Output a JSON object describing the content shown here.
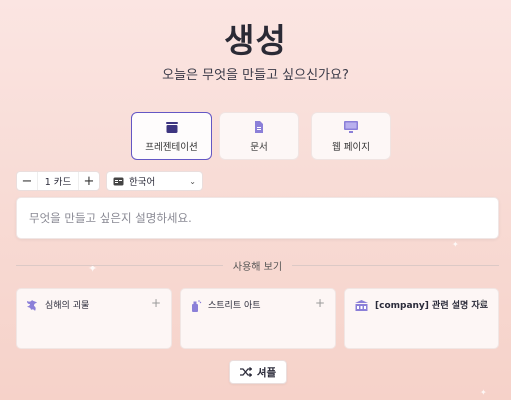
{
  "header": {
    "title": "생성",
    "subtitle": "오늘은 무엇을 만들고 싶으신가요?"
  },
  "types": [
    {
      "label": "프레젠테이션",
      "icon": "presentation-icon",
      "selected": true
    },
    {
      "label": "문서",
      "icon": "document-icon",
      "selected": false
    },
    {
      "label": "웹 페이지",
      "icon": "webpage-icon",
      "selected": false
    }
  ],
  "controls": {
    "card_count": "1 카드",
    "minus": "−",
    "plus": "+",
    "language": "한국어"
  },
  "prompt": {
    "placeholder": "무엇을 만들고 싶은지 설명하세요."
  },
  "examples_section": {
    "label": "사용해 보기",
    "items": [
      {
        "text": "심해의 괴물",
        "icon": "sea-monster-icon"
      },
      {
        "text": "스트리트 아트",
        "icon": "spray-can-icon"
      },
      {
        "text": "[company] 관련 설명 자료",
        "icon": "building-icon"
      }
    ]
  },
  "shuffle": {
    "label": "셔플"
  },
  "colors": {
    "accent": "#6457c4",
    "icon_purple": "#8b7fd8"
  }
}
